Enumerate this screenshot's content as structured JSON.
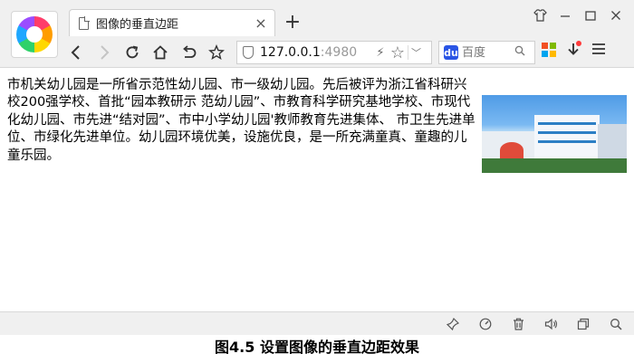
{
  "browser": {
    "tab": {
      "title": "图像的垂直边距",
      "close_label": "×"
    },
    "new_tab_label": "+",
    "address": {
      "url_host": "127.0.0.1",
      "url_port": ":4980"
    },
    "search": {
      "placeholder": "百度",
      "engine_icon": "baidu-paw-icon"
    },
    "colors": {
      "chrome_bg": "#f0f0f0",
      "baidu_blue": "#2a55e5",
      "notify_red": "#ff3b3b"
    }
  },
  "page": {
    "paragraph": "市机关幼儿园是一所省示范性幼儿园、市一级幼儿园。先后被评为浙江省科研兴校200强学校、首批“园本教研示 范幼儿园”、市教育科学研究基地学校、市现代化幼儿园、市先进“结对园”、市中小学幼儿园'教师教育先进集体、 市卫生先进单位、市绿化先进单位。幼儿园环境优美，设施优良，是一所充满童真、童趣的儿童乐园。"
  },
  "caption": "图4.5 设置图像的垂直边距效果"
}
